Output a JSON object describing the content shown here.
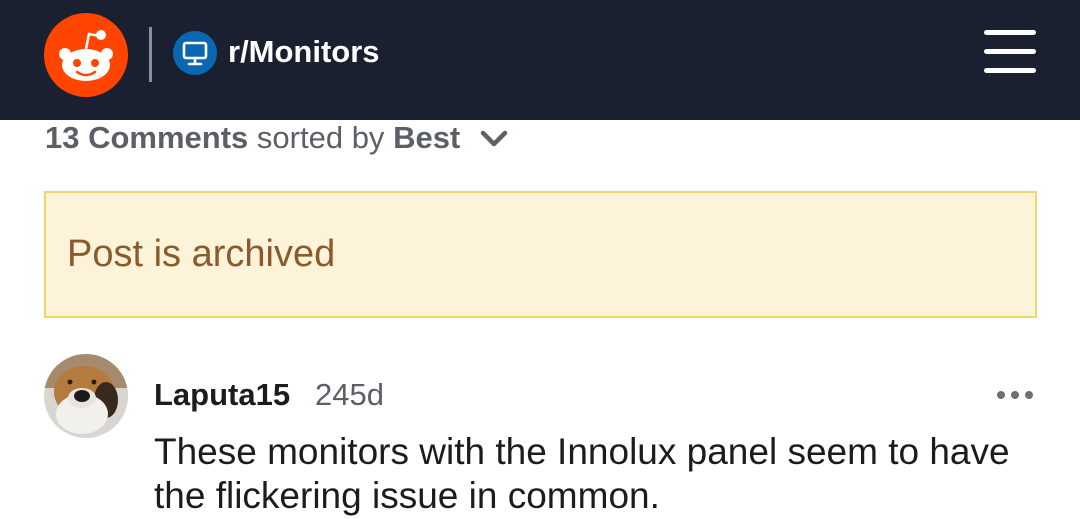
{
  "header": {
    "logo_icon": "reddit-snoo-icon",
    "subreddit_icon": "monitor-icon",
    "subreddit_name": "r/Monitors",
    "menu_icon": "hamburger-menu-icon",
    "bar_color": "#1a2030",
    "logo_color": "#ff4500",
    "subreddit_icon_color": "#0a68b0"
  },
  "comments": {
    "count_label": "13 Comments",
    "sorted_by_label": "sorted by",
    "sort_value": "Best",
    "sort_icon": "chevron-down-icon"
  },
  "archived_notice": {
    "text": "Post is archived",
    "background": "#fdf3d8",
    "border": "#f0d76c",
    "text_color": "#8a5a2c"
  },
  "comment": {
    "username": "Laputa15",
    "age": "245d",
    "body": "These monitors with the Innolux panel seem to have the flickering issue in common.",
    "more_icon": "more-options-icon"
  }
}
